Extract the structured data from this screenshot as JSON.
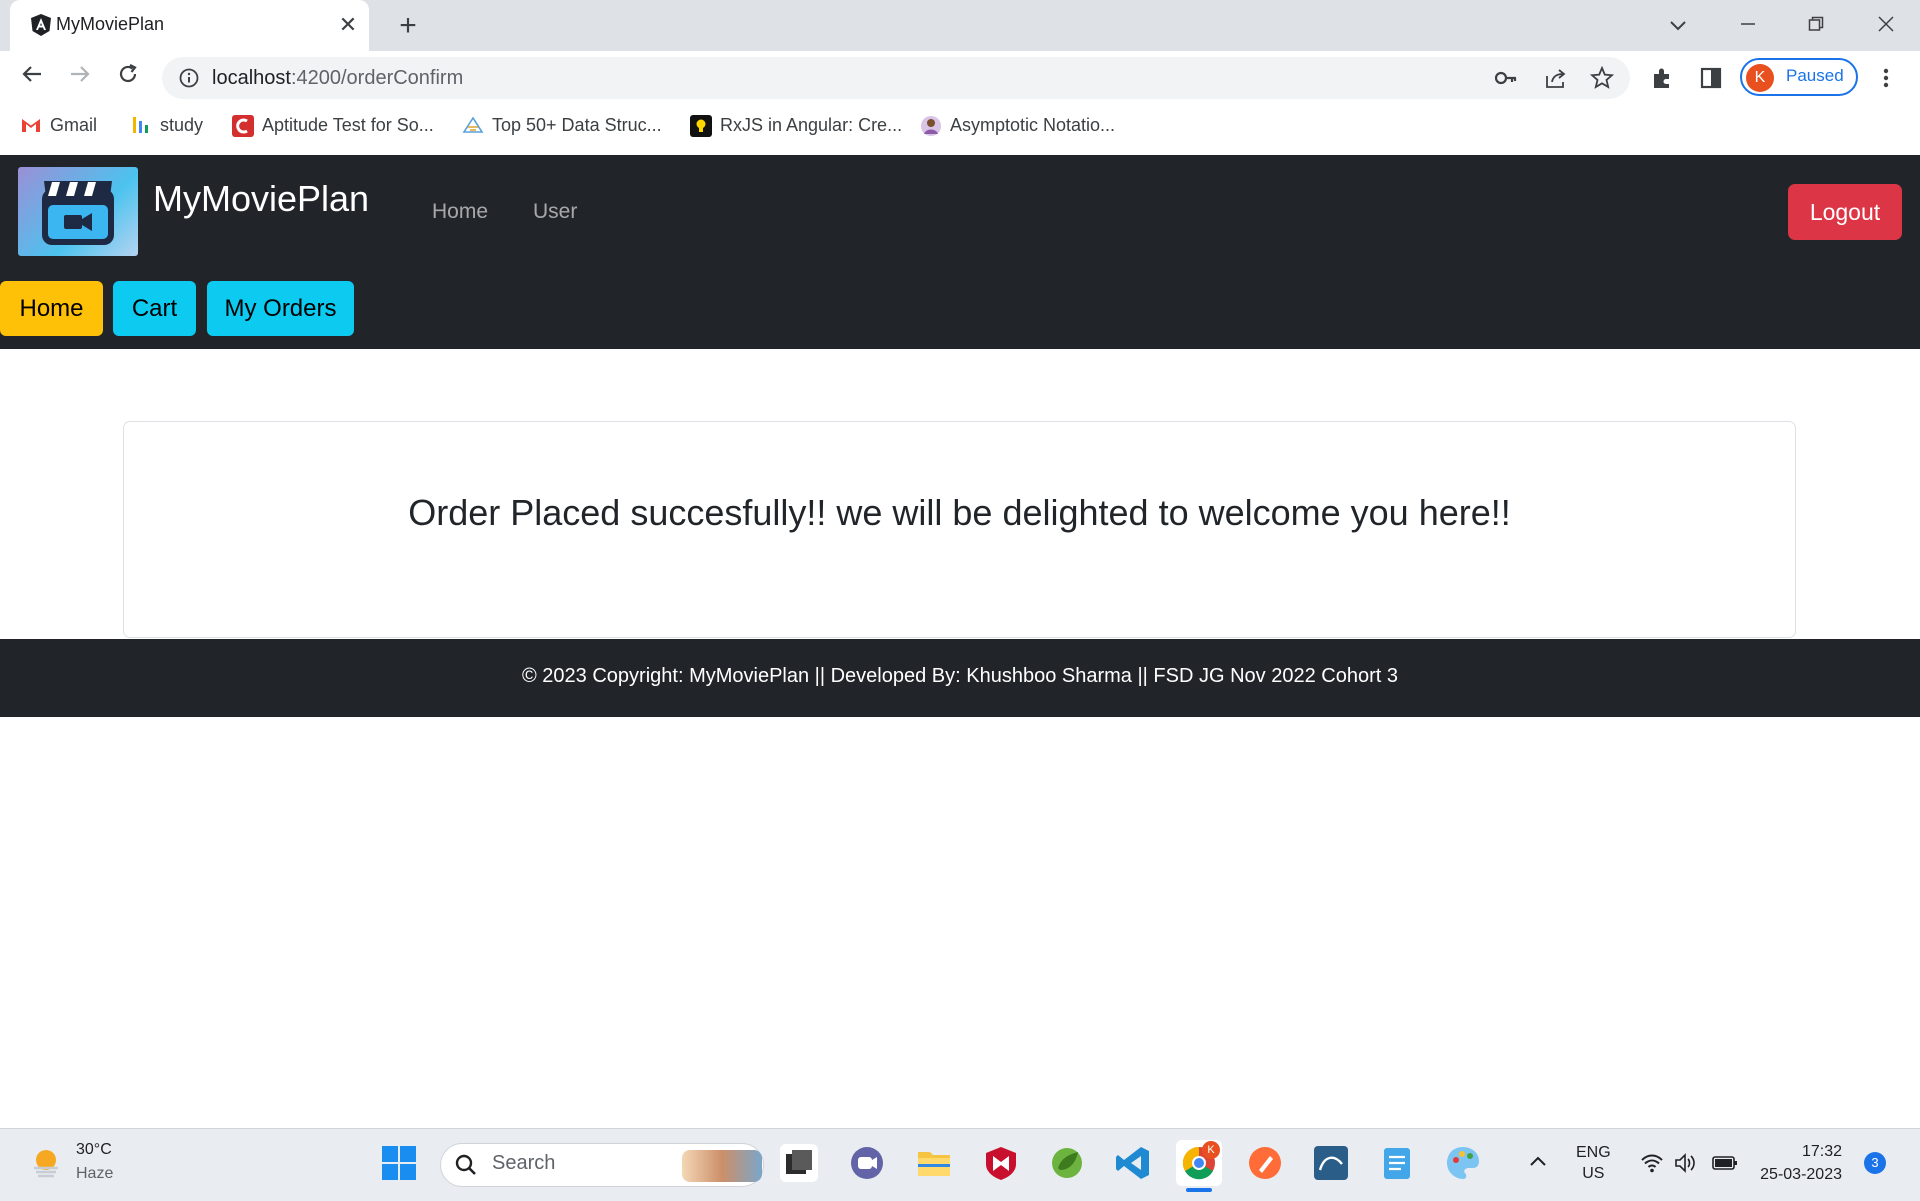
{
  "browser": {
    "tab_title": "MyMoviePlan",
    "tab_close": "✕",
    "new_tab": "+",
    "url_host": "localhost",
    "url_path": ":4200/orderConfirm",
    "profile_initial": "K",
    "profile_status": "Paused",
    "bookmarks": [
      {
        "label": "Gmail"
      },
      {
        "label": "study"
      },
      {
        "label": "Aptitude Test for So..."
      },
      {
        "label": "Top 50+ Data Struc..."
      },
      {
        "label": "RxJS in Angular: Cre..."
      },
      {
        "label": "Asymptotic Notatio..."
      }
    ]
  },
  "app": {
    "brand": "MyMoviePlan",
    "nav": {
      "home": "Home",
      "user": "User"
    },
    "logout": "Logout",
    "subnav": {
      "home": "Home",
      "cart": "Cart",
      "orders": "My Orders"
    },
    "message": "Order Placed succesfully!! we will be delighted to welcome you here!!",
    "footer": "© 2023 Copyright: MyMoviePlan || Developed By: Khushboo Sharma || FSD JG Nov 2022 Cohort 3"
  },
  "colors": {
    "header_bg": "#212529",
    "logout_bg": "#dc3545",
    "home_btn_bg": "#ffc107",
    "info_btn_bg": "#0dcaf0"
  },
  "taskbar": {
    "temperature": "30°C",
    "weather": "Haze",
    "search_placeholder": "Search",
    "lang_1": "ENG",
    "lang_2": "US",
    "time": "17:32",
    "date": "25-03-2023",
    "notifications": "3",
    "chrome_badge": "K"
  }
}
